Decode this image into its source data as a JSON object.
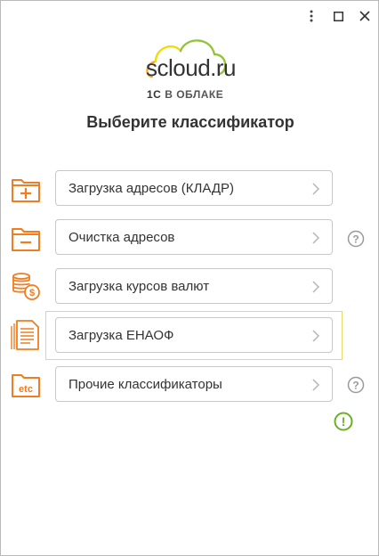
{
  "window": {
    "menu_icon": "kebab-menu-icon",
    "maximize_icon": "maximize-icon",
    "close_icon": "close-icon"
  },
  "logo": {
    "brand": "scloud",
    "brand_suffix": ".ru",
    "onec": "1С",
    "sub": "В ОБЛАКЕ",
    "cloud_colors": [
      "#f5a623",
      "#8cc63f",
      "#f0e000"
    ]
  },
  "title": "Выберите классификатор",
  "items": [
    {
      "label": "Загрузка адресов (КЛАДР)",
      "icon": "folder-plus-icon",
      "help": false
    },
    {
      "label": "Очистка адресов",
      "icon": "folder-minus-icon",
      "help": true
    },
    {
      "label": "Загрузка курсов валют",
      "icon": "coins-icon",
      "help": false
    },
    {
      "label": "Загрузка ЕНАОФ",
      "icon": "document-list-icon",
      "help": false,
      "highlighted": true
    },
    {
      "label": "Прочие классификаторы",
      "icon": "folder-etc-icon",
      "help": true
    }
  ],
  "folder_etc_text": "etc",
  "help_symbol": "?",
  "alert_symbol": "!",
  "colors": {
    "accent_orange": "#f07d1f",
    "alert_green": "#6ab023",
    "help_gray": "#9a9a9a",
    "highlight_border": "#e7d96a"
  }
}
